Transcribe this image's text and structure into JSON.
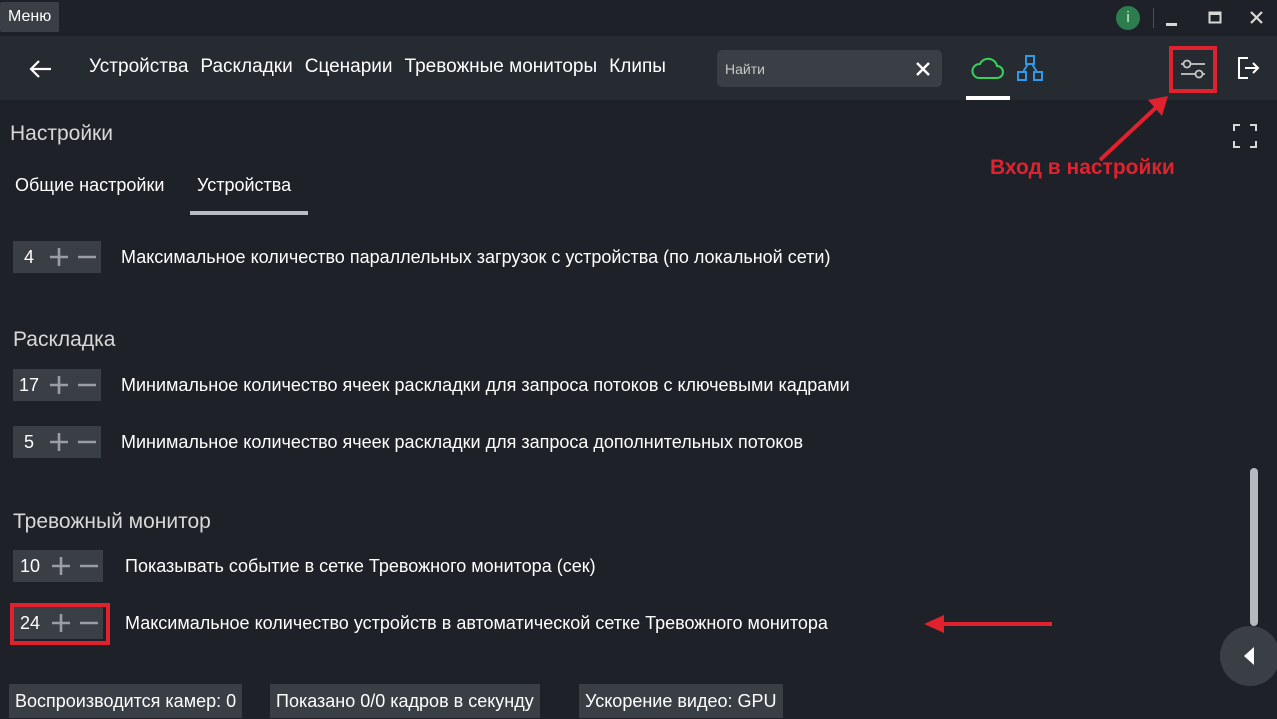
{
  "titlebar": {
    "menu_label": "Меню",
    "info_icon_label": "i"
  },
  "nav": {
    "tabs": [
      {
        "label": "Устройства"
      },
      {
        "label": "Раскладки"
      },
      {
        "label": "Сценарии"
      },
      {
        "label": "Тревожные мониторы"
      },
      {
        "label": "Клипы"
      }
    ],
    "search_placeholder": "Найти",
    "active_view": "cloud"
  },
  "annotation": {
    "settings_hint": "Вход в настройки"
  },
  "settings": {
    "title": "Настройки",
    "sub_tabs": [
      {
        "label": "Общие настройки"
      },
      {
        "label": "Устройства",
        "active": true
      }
    ],
    "device_rows": [
      {
        "value": "4",
        "label": "Максимальное количество параллельных загрузок с устройства (по локальной сети)"
      }
    ],
    "layout_section": "Раскладка",
    "layout_rows": [
      {
        "value": "17",
        "label": "Минимальное количество ячеек раскладки для запроса потоков с ключевыми кадрами"
      },
      {
        "value": "5",
        "label": "Минимальное количество ячеек раскладки для запроса дополнительных потоков"
      }
    ],
    "alarm_section": "Тревожный монитор",
    "alarm_rows": [
      {
        "value": "10",
        "label": "Показывать событие в сетке Тревожного монитора (сек)"
      },
      {
        "value": "24",
        "label": "Максимальное количество устройств в автоматической сетке Тревожного монитора"
      }
    ]
  },
  "statusbar": {
    "cameras": "Воспроизводится камер: 0",
    "fps": "Показано 0/0 кадров в секунду",
    "accel": "Ускорение видео: GPU"
  },
  "colors": {
    "background": "#1e2127",
    "navbar": "#262a31",
    "control": "#3a3e45",
    "accent_green": "#39d05a",
    "accent_blue": "#2f9be8",
    "annotation_red": "#e0212e"
  }
}
